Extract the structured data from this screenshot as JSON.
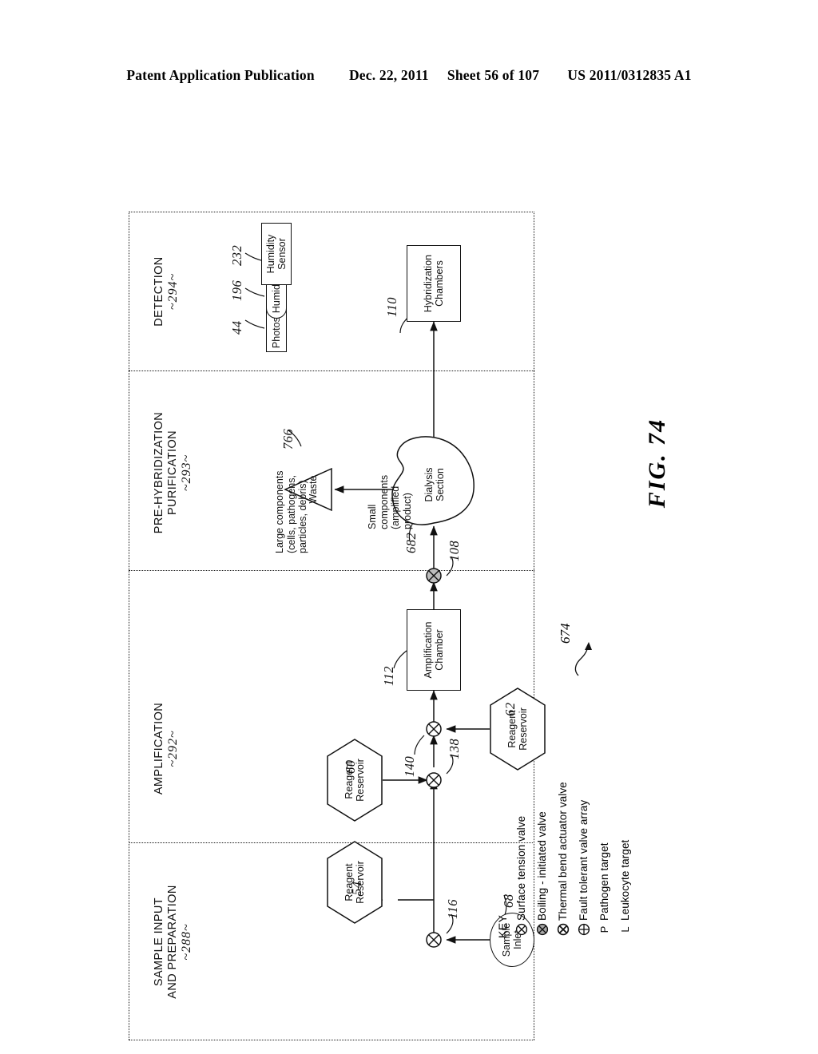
{
  "header": {
    "publication": "Patent Application Publication",
    "date": "Dec. 22, 2011",
    "sheet": "Sheet 56 of 107",
    "number": "US 2011/0312835 A1"
  },
  "figure": {
    "label": "FIG. 74",
    "assembly_ref": "674"
  },
  "sections": [
    {
      "id": "sample-input",
      "title_line1": "SAMPLE INPUT",
      "title_line2": "AND PREPARATION",
      "ref": "~288~"
    },
    {
      "id": "amplification",
      "title_line1": "AMPLIFICATION",
      "title_line2": "",
      "ref": "~292~"
    },
    {
      "id": "pre-hybridization",
      "title_line1": "PRE-HYBRIDIZATION",
      "title_line2": "PURIFICATION",
      "ref": "~293~"
    },
    {
      "id": "detection",
      "title_line1": "DETECTION",
      "title_line2": "",
      "ref": "~294~"
    }
  ],
  "nodes": {
    "sample_inlet": {
      "label": "Sample\nInlet",
      "ref": "68"
    },
    "reagent_reservoir_54": {
      "label": "Reagent\nReservoir",
      "ref": "54"
    },
    "reagent_reservoir_60": {
      "label": "Reagent\nReservoir",
      "ref": "60"
    },
    "reagent_reservoir_62": {
      "label": "Reagent\nReservoir",
      "ref": "62"
    },
    "amplification_chamber": {
      "label": "Amplification\nChamber",
      "ref": "112"
    },
    "dialysis_section": {
      "label": "Dialysis\nSection",
      "ref": "682"
    },
    "waste": {
      "label": "Waste",
      "ref": "766"
    },
    "hybridization_chambers": {
      "label": "Hybridization\nChambers",
      "ref": "110"
    },
    "photosensor": {
      "label": "Photosensor",
      "ref": "44"
    },
    "humidifier": {
      "label": "Humidifier",
      "ref": "196"
    },
    "humidity_sensor": {
      "label": "Humidity\nSensor",
      "ref": "232"
    }
  },
  "valves": [
    {
      "id": "valve-116",
      "ref": "116"
    },
    {
      "id": "valve-138",
      "ref": "138"
    },
    {
      "id": "valve-140",
      "ref": "140"
    },
    {
      "id": "valve-108",
      "ref": "108"
    }
  ],
  "annotations": {
    "small_components": "Small\ncomponents\n(amplified\nproduct)",
    "large_components": "Large components\n(cells, pathogens,\nparticles, debris)"
  },
  "key": {
    "title": "KEY",
    "items": [
      {
        "symbol": "surface-tension-valve-icon",
        "label": "Surface tension valve"
      },
      {
        "symbol": "boiling-initiated-valve-icon",
        "label": "Boiling - initiated valve"
      },
      {
        "symbol": "thermal-bend-actuator-valve-icon",
        "label": "Thermal bend actuator valve"
      },
      {
        "symbol": "fault-tolerant-valve-array-icon",
        "label": "Fault tolerant valve array"
      },
      {
        "symbol": "P",
        "label": "Pathogen target"
      },
      {
        "symbol": "L",
        "label": "Leukocyte target"
      }
    ]
  }
}
